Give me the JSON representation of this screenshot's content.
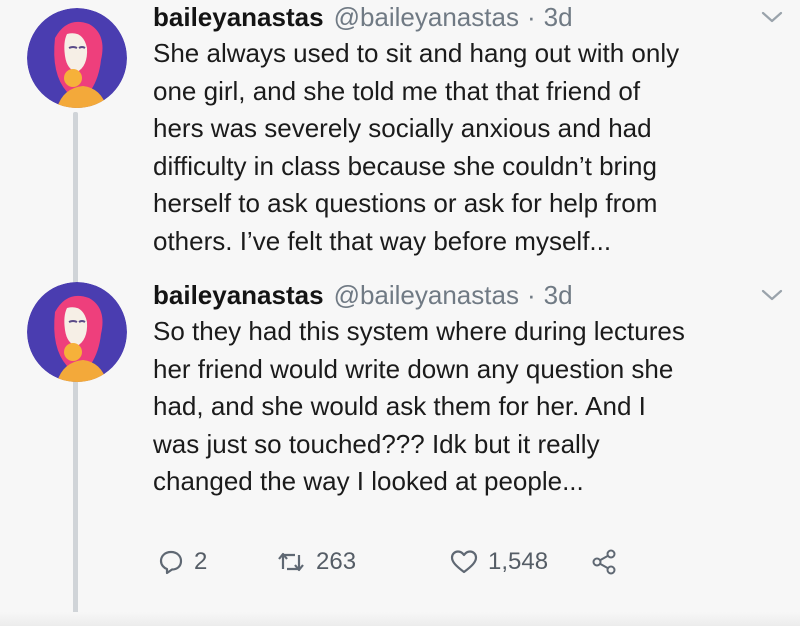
{
  "tweets": [
    {
      "name": "baileyanastas",
      "handle": "@baileyanastas",
      "separator": "·",
      "time": "3d",
      "text": "She always used to sit and hang out with only\none girl, and she told me that that friend of\nhers was severely socially anxious and had\ndifficulty in class because she couldn’t bring\nherself to ask questions or ask for help from\nothers. I’ve felt that way before myself..."
    },
    {
      "name": "baileyanastas",
      "handle": "@baileyanastas",
      "separator": "·",
      "time": "3d",
      "text": "So they had this system where during lectures\nher friend would write down any question she\nhad, and she would ask them for her. And I\nwas just so touched??? Idk but it really\nchanged the way I looked at people..."
    }
  ],
  "actions": {
    "reply_count": "2",
    "retweet_count": "263",
    "like_count": "1,548"
  },
  "icons": [
    "avatar",
    "chevron-down-icon",
    "reply-icon",
    "retweet-icon",
    "heart-icon",
    "share-icon"
  ]
}
